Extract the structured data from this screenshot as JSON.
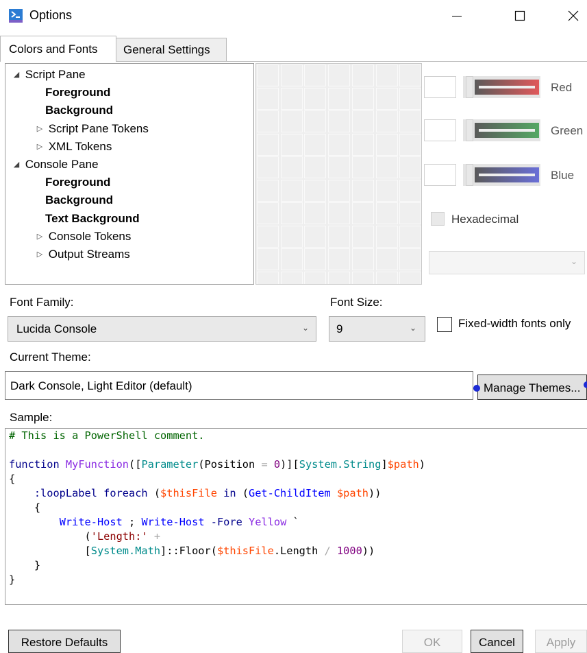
{
  "window": {
    "title": "Options",
    "icon": "powershell-ise-icon",
    "controls": {
      "minimize": "minimize-icon",
      "maximize": "maximize-icon",
      "close": "close-icon"
    }
  },
  "tabs": [
    {
      "label": "Colors and Fonts",
      "selected": true
    },
    {
      "label": "General Settings",
      "selected": false
    }
  ],
  "tree": {
    "items": [
      {
        "label": "Script Pane",
        "level": 0,
        "expander": "◢",
        "bold": false
      },
      {
        "label": "Foreground",
        "level": 1,
        "expander": "",
        "bold": true
      },
      {
        "label": "Background",
        "level": 1,
        "expander": "",
        "bold": true
      },
      {
        "label": "Script Pane Tokens",
        "level": 1,
        "expander": "▷",
        "bold": false
      },
      {
        "label": "XML Tokens",
        "level": 1,
        "expander": "▷",
        "bold": false
      },
      {
        "label": "Console Pane",
        "level": 0,
        "expander": "◢",
        "bold": false
      },
      {
        "label": "Foreground",
        "level": 1,
        "expander": "",
        "bold": true
      },
      {
        "label": "Background",
        "level": 1,
        "expander": "",
        "bold": true
      },
      {
        "label": "Text Background",
        "level": 1,
        "expander": "",
        "bold": true
      },
      {
        "label": "Console Tokens",
        "level": 1,
        "expander": "▷",
        "bold": false
      },
      {
        "label": "Output Streams",
        "level": 1,
        "expander": "▷",
        "bold": false
      }
    ]
  },
  "color_editor": {
    "red_label": "Red",
    "green_label": "Green",
    "blue_label": "Blue",
    "red_value": "",
    "green_value": "",
    "blue_value": "",
    "red_color": "#e0595b",
    "green_color": "#55a864",
    "blue_color": "#6a6fd8",
    "hexadecimal_label": "Hexadecimal",
    "hexadecimal_checked": false,
    "hex_combo_value": ""
  },
  "font": {
    "family_label": "Font Family:",
    "family_value": "Lucida Console",
    "size_label": "Font Size:",
    "size_value": "9",
    "fixed_width_label": "Fixed-width fonts only",
    "fixed_width_checked": false
  },
  "theme": {
    "label": "Current Theme:",
    "value": "Dark Console, Light Editor (default)",
    "manage_button": "Manage Themes..."
  },
  "sample": {
    "label": "Sample:",
    "lines": [
      [
        {
          "t": "# This is a PowerShell comment.",
          "c": "comment"
        }
      ],
      [
        {
          "t": "",
          "c": "plain"
        }
      ],
      [
        {
          "t": "function",
          "c": "kw"
        },
        {
          "t": " ",
          "c": "plain"
        },
        {
          "t": "MyFunction",
          "c": "fn"
        },
        {
          "t": "([",
          "c": "plain"
        },
        {
          "t": "Parameter",
          "c": "type"
        },
        {
          "t": "(Position ",
          "c": "plain"
        },
        {
          "t": "=",
          "c": "op"
        },
        {
          "t": " ",
          "c": "plain"
        },
        {
          "t": "0",
          "c": "num"
        },
        {
          "t": ")][",
          "c": "plain"
        },
        {
          "t": "System.String",
          "c": "type"
        },
        {
          "t": "]",
          "c": "plain"
        },
        {
          "t": "$path",
          "c": "var"
        },
        {
          "t": ")",
          "c": "plain"
        }
      ],
      [
        {
          "t": "{",
          "c": "plain"
        }
      ],
      [
        {
          "t": "    :loopLabel ",
          "c": "kw"
        },
        {
          "t": "foreach",
          "c": "kw"
        },
        {
          "t": " (",
          "c": "plain"
        },
        {
          "t": "$thisFile",
          "c": "var"
        },
        {
          "t": " ",
          "c": "plain"
        },
        {
          "t": "in",
          "c": "kw"
        },
        {
          "t": " (",
          "c": "plain"
        },
        {
          "t": "Get-ChildItem",
          "c": "cmd"
        },
        {
          "t": " ",
          "c": "plain"
        },
        {
          "t": "$path",
          "c": "var"
        },
        {
          "t": "))",
          "c": "plain"
        }
      ],
      [
        {
          "t": "    {",
          "c": "plain"
        }
      ],
      [
        {
          "t": "        ",
          "c": "plain"
        },
        {
          "t": "Write-Host",
          "c": "cmd"
        },
        {
          "t": " ; ",
          "c": "plain"
        },
        {
          "t": "Write-Host",
          "c": "cmd"
        },
        {
          "t": " ",
          "c": "plain"
        },
        {
          "t": "-Fore",
          "c": "kw"
        },
        {
          "t": " ",
          "c": "plain"
        },
        {
          "t": "Yellow",
          "c": "fn"
        },
        {
          "t": " `",
          "c": "plain"
        }
      ],
      [
        {
          "t": "            (",
          "c": "plain"
        },
        {
          "t": "'Length:'",
          "c": "str"
        },
        {
          "t": " ",
          "c": "plain"
        },
        {
          "t": "+",
          "c": "op"
        }
      ],
      [
        {
          "t": "            [",
          "c": "plain"
        },
        {
          "t": "System.Math",
          "c": "type"
        },
        {
          "t": "]::Floor(",
          "c": "plain"
        },
        {
          "t": "$thisFile",
          "c": "var"
        },
        {
          "t": ".Length ",
          "c": "plain"
        },
        {
          "t": "/",
          "c": "op"
        },
        {
          "t": " ",
          "c": "plain"
        },
        {
          "t": "1000",
          "c": "num"
        },
        {
          "t": "))",
          "c": "plain"
        }
      ],
      [
        {
          "t": "    }",
          "c": "plain"
        }
      ],
      [
        {
          "t": "}",
          "c": "plain"
        }
      ]
    ]
  },
  "buttons": {
    "restore": "Restore Defaults",
    "ok": "OK",
    "cancel": "Cancel",
    "apply": "Apply"
  }
}
